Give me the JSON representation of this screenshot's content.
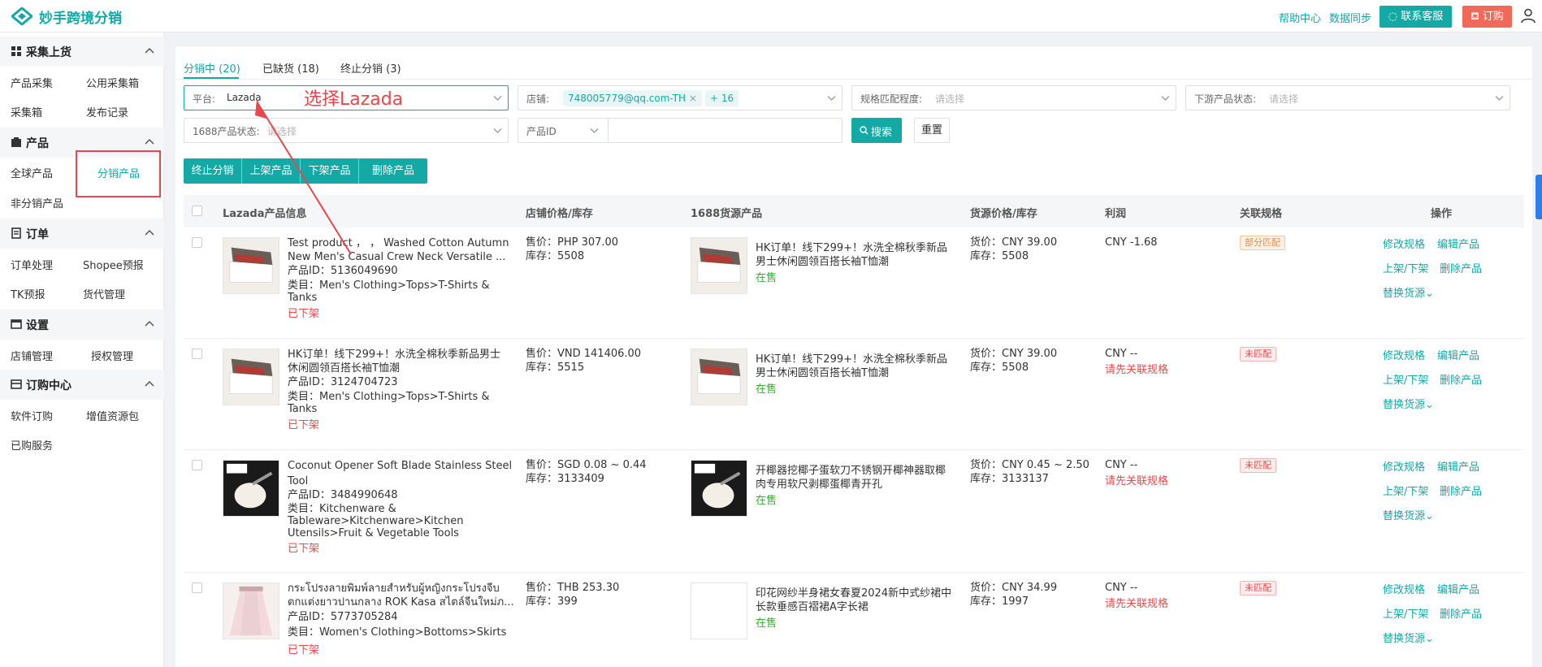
{
  "header": {
    "app_title": "妙手跨境分销",
    "help_link": "帮助中心",
    "sync_link": "数据同步",
    "service_button": "联系客服",
    "order_button": "订购",
    "colors": {
      "brand": "#13a8a8",
      "order": "#f06a5c"
    }
  },
  "sidebar": {
    "sections": [
      {
        "title": "采集上货",
        "items": [
          "产品采集",
          "公用采集箱",
          "采集箱",
          "发布记录"
        ]
      },
      {
        "title": "产品",
        "items": [
          "全球产品",
          "分销产品",
          "非分销产品"
        ]
      },
      {
        "title": "订单",
        "items": [
          "订单处理",
          "Shopee预报",
          "TK预报",
          "货代管理"
        ]
      },
      {
        "title": "设置",
        "items": [
          "店铺管理",
          "授权管理"
        ]
      },
      {
        "title": "订购中心",
        "items": [
          "软件订购",
          "增值资源包",
          "已购服务"
        ]
      }
    ]
  },
  "tabs": [
    {
      "label": "分销中 (20)"
    },
    {
      "label": "已缺货 (18)"
    },
    {
      "label": "终止分销 (3)"
    }
  ],
  "filters": {
    "platform_label": "平台:",
    "platform_value": "Lazada",
    "shop_label": "店铺:",
    "shop_tag": "748005779@qq.com-TH",
    "shop_more": "+ 16",
    "spec_match_label": "规格匹配程度:",
    "spec_match_placeholder": "请选择",
    "downstream_label": "下游产品状态:",
    "downstream_placeholder": "请选择",
    "status_1688_label": "1688产品状态:",
    "status_1688_placeholder": "请选择",
    "id_type": "产品ID",
    "search_button": "搜索",
    "reset_button": "重置"
  },
  "annotation": "选择Lazada",
  "actions": [
    "终止分销",
    "上架产品",
    "下架产品",
    "删除产品"
  ],
  "table": {
    "headers": [
      "Lazada产品信息",
      "店铺价格/库存",
      "1688货源产品",
      "货源价格/库存",
      "利润",
      "关联规格",
      "操作"
    ],
    "rows": [
      {
        "title1": "Test product ， ，  Washed Cotton Autumn",
        "title2": "New Men's Casual Crew Neck Versatile ...",
        "product_id": "产品ID：5136049690",
        "cat1": "类目：Men's Clothing>Tops>T-Shirts &",
        "cat2": "Tanks",
        "cat3": "",
        "status": "已下架",
        "price": "售价：PHP 307.00",
        "stock": "库存：5508",
        "src_title1": "HK订单！线下299+！水洗全棉秋季新品",
        "src_title2": "男士休闲圆领百搭长袖T恤潮",
        "src_status": "在售",
        "src_price": "货价：CNY 39.00",
        "src_stock": "库存：5508",
        "profit": "CNY -1.68",
        "profit_note": "",
        "match": "部分匹配",
        "match_type": "partial"
      },
      {
        "title1": "HK订单！线下299+！水洗全棉秋季新品男士",
        "title2": "休闲圆领百搭长袖T恤潮",
        "product_id": "产品ID：3124704723",
        "cat1": "类目：Men's Clothing>Tops>T-Shirts &",
        "cat2": "Tanks",
        "cat3": "",
        "status": "已下架",
        "price": "售价：VND 141406.00",
        "stock": "库存：5515",
        "src_title1": "HK订单！线下299+！水洗全棉秋季新品",
        "src_title2": "男士休闲圆领百搭长袖T恤潮",
        "src_status": "在售",
        "src_price": "货价：CNY 39.00",
        "src_stock": "库存：5508",
        "profit": "CNY --",
        "profit_note": "请先关联规格",
        "match": "未匹配",
        "match_type": "none"
      },
      {
        "title1": "Coconut Opener Soft Blade Stainless Steel",
        "title2": "Tool",
        "product_id": "产品ID：3484990648",
        "cat1": "类目：Kitchenware &",
        "cat2": "Tableware>Kitchenware>Kitchen",
        "cat3": "Utensils>Fruit & Vegetable Tools",
        "status": "已下架",
        "price": "售价：SGD 0.08 ~ 0.44",
        "stock": "库存：3133409",
        "src_title1": "开椰器挖椰子蛋软刀不锈钢开椰神器取椰",
        "src_title2": "肉专用软尺剥椰蛋椰青开孔",
        "src_status": "在售",
        "src_price": "货价：CNY 0.45 ~ 2.50",
        "src_stock": "库存：3133137",
        "profit": "CNY --",
        "profit_note": "请先关联规格",
        "match": "未匹配",
        "match_type": "none"
      },
      {
        "title1": "กระโปรงลายพิมพ์ลายสำหรับผู้หญิงกระโปรงจีบ",
        "title2": "ตกแต่งยาวปานกลาง ROK Kasa สไตล์จีนใหม่ภ...",
        "product_id": "产品ID：5773705284",
        "cat1": "类目：Women's Clothing>Bottoms>Skirts",
        "cat2": "",
        "cat3": "",
        "status": "已下架",
        "price": "售价：THB 253.30",
        "stock": "库存：399",
        "src_title1": "印花网纱半身裙女春夏2024新中式纱裙中",
        "src_title2": "长款垂感百褶裙A字长裙",
        "src_status": "在售",
        "src_price": "货价：CNY 34.99",
        "src_stock": "库存：1997",
        "profit": "CNY --",
        "profit_note": "请先关联规格",
        "match": "未匹配",
        "match_type": "none"
      }
    ],
    "ops": {
      "edit_spec": "修改规格",
      "edit_product": "编辑产品",
      "toggle_listing": "上架/下架",
      "delete_product": "删除产品",
      "replace_source": "替换货源"
    }
  }
}
